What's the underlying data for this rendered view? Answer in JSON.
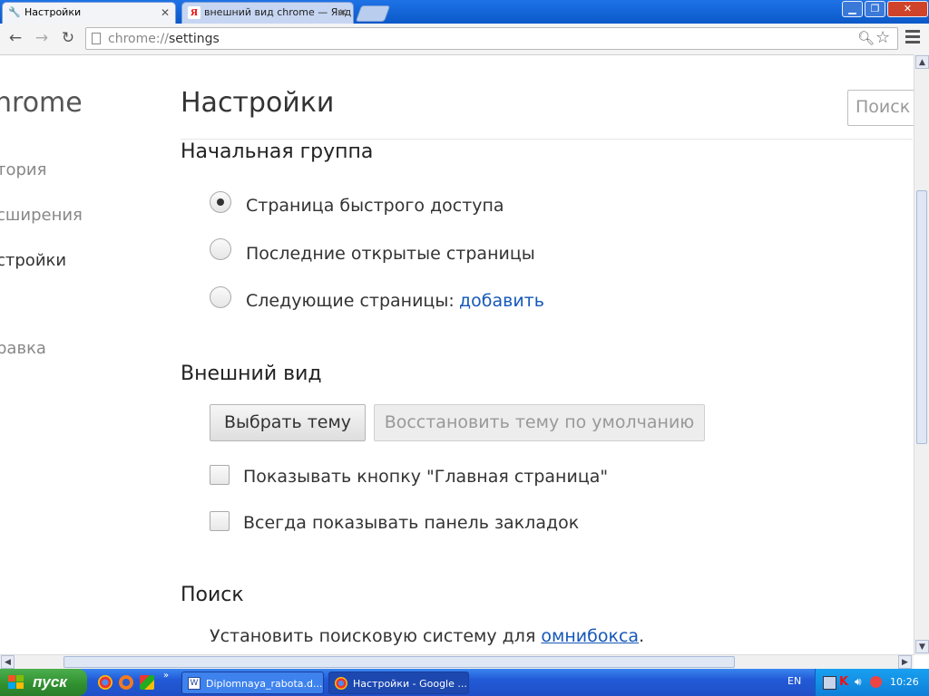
{
  "browser": {
    "tabs": [
      {
        "title": "Настройки",
        "icon": "wrench-icon",
        "active": true
      },
      {
        "title": "внешний вид chrome — Янд",
        "icon": "yandex-icon",
        "active": false
      }
    ],
    "yandex_letter": "Я",
    "address": {
      "scheme": "chrome://",
      "path": "settings"
    }
  },
  "sidebar": {
    "title": "hrome",
    "items": [
      {
        "label": "тория"
      },
      {
        "label": "сширения"
      },
      {
        "label": "стройки"
      },
      {
        "label": "равка"
      }
    ]
  },
  "settings": {
    "page_title": "Настройки",
    "search_placeholder": "Поиск",
    "startup": {
      "title": "Начальная группа",
      "options": [
        {
          "label": "Страница быстрого доступа",
          "checked": true
        },
        {
          "label": "Последние открытые страницы",
          "checked": false
        },
        {
          "label": "Следующие страницы:",
          "checked": false
        }
      ],
      "add_link": "добавить"
    },
    "appearance": {
      "title": "Внешний вид",
      "choose_theme": "Выбрать тему",
      "reset_theme": "Восстановить тему по умолчанию",
      "show_home": "Показывать кнопку \"Главная страница\"",
      "show_bookmarks": "Всегда показывать панель закладок"
    },
    "search": {
      "title": "Поиск",
      "text": "Установить поисковую систему для ",
      "link": "омнибокса",
      "suffix": "."
    }
  },
  "taskbar": {
    "start_label": "пуск",
    "tasks": [
      {
        "label": "Diplomnaya_rabota.d..."
      },
      {
        "label": "Настройки - Google ..."
      }
    ],
    "lang": "EN",
    "clock": "10:26"
  }
}
